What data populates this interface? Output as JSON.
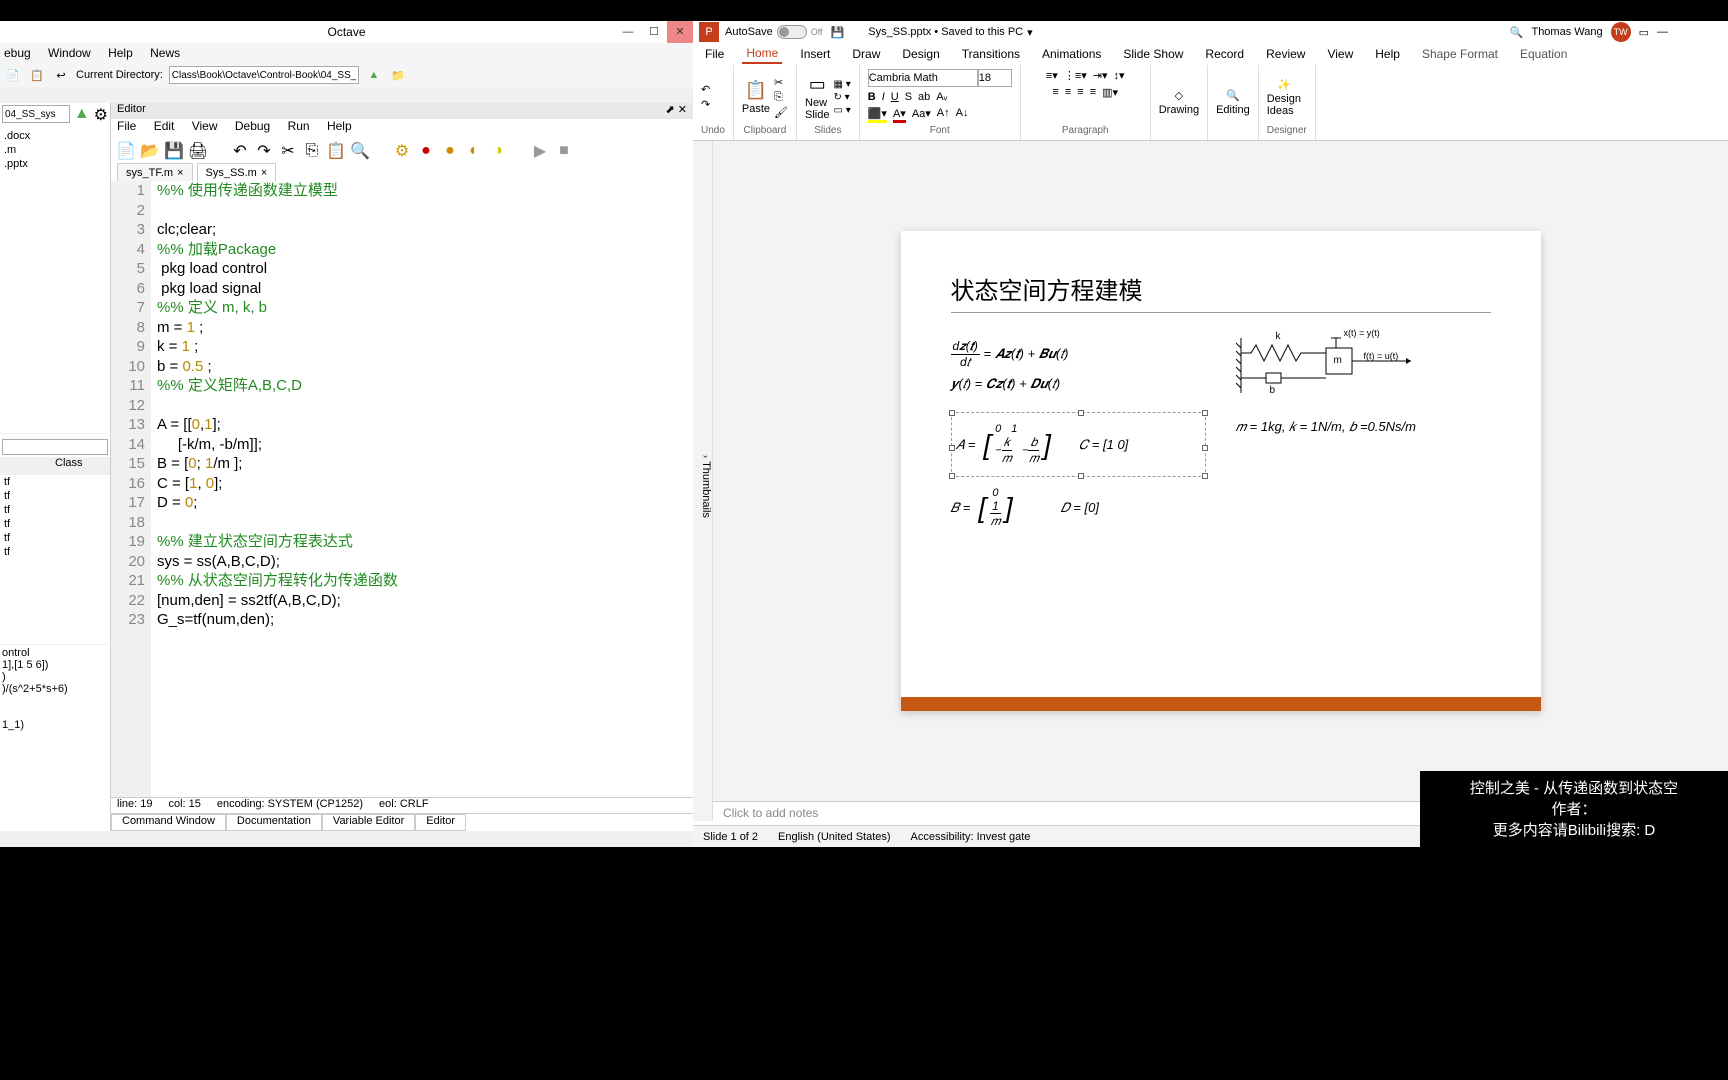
{
  "octave": {
    "title": "Octave",
    "menu": [
      "ebug",
      "Window",
      "Help",
      "News"
    ],
    "current_dir_label": "Current Directory:",
    "current_dir": "Class\\Book\\Octave\\Control-Book\\04_SS_sys",
    "files": {
      "sel": "04_SS_sys",
      "list": [
        ".docx",
        ".m",
        ".pptx"
      ]
    },
    "ws": {
      "headers": [
        "",
        "Class"
      ],
      "rows": [
        "tf",
        "tf",
        "tf",
        "tf",
        "tf",
        "tf"
      ]
    },
    "cmd": "ontrol\n1],[1 5 6])\n)\n)/(s^2+5*s+6)\n\n\n1_1)\n",
    "editor": {
      "pane": "Editor",
      "menu": [
        "File",
        "Edit",
        "View",
        "Debug",
        "Run",
        "Help"
      ],
      "tabs": [
        {
          "name": "sys_TF.m"
        },
        {
          "name": "Sys_SS.m",
          "active": true
        }
      ],
      "code": [
        {
          "n": 1,
          "h": "<span class='c'>%% 使用传递函数建立模型</span>"
        },
        {
          "n": 2,
          "h": ""
        },
        {
          "n": 3,
          "h": "clc;clear;"
        },
        {
          "n": 4,
          "h": "<span class='c'>%% 加载Package</span>"
        },
        {
          "n": 5,
          "h": " pkg load control"
        },
        {
          "n": 6,
          "h": " pkg load signal"
        },
        {
          "n": 7,
          "h": "<span class='c'>%% 定义 m, k, b</span>"
        },
        {
          "n": 8,
          "h": "m = <span class='n'>1</span> ;"
        },
        {
          "n": 9,
          "h": "k = <span class='n'>1</span> ;"
        },
        {
          "n": 10,
          "h": "b = <span class='n'>0.5</span> ;"
        },
        {
          "n": 11,
          "h": "<span class='c'>%% 定义矩阵A,B,C,D</span>"
        },
        {
          "n": 12,
          "h": ""
        },
        {
          "n": 13,
          "h": "A = [[<span class='n'>0</span>,<span class='n'>1</span>];"
        },
        {
          "n": 14,
          "h": "     [-k/m, -b/m]];"
        },
        {
          "n": 15,
          "h": "B = [<span class='n'>0</span>; <span class='n'>1</span>/m ];"
        },
        {
          "n": 16,
          "h": "C = [<span class='n'>1</span>, <span class='n'>0</span>];"
        },
        {
          "n": 17,
          "h": "D = <span class='n'>0</span>;"
        },
        {
          "n": 18,
          "h": ""
        },
        {
          "n": 19,
          "h": "<span class='c'>%% 建立状态空间方程表达式</span>"
        },
        {
          "n": 20,
          "h": "sys = ss(A,B,C,D);"
        },
        {
          "n": 21,
          "h": "<span class='c'>%% 从状态空间方程转化为传递函数</span>"
        },
        {
          "n": 22,
          "h": "[num,den] = ss2tf(A,B,C,D);"
        },
        {
          "n": 23,
          "h": "G_s=tf(num,den);"
        }
      ],
      "status": {
        "line": "line: 19",
        "col": "col: 15",
        "enc": "encoding: SYSTEM (CP1252)",
        "eol": "eol: CRLF"
      },
      "btabs": [
        "Command Window",
        "Documentation",
        "Variable Editor",
        "Editor"
      ]
    }
  },
  "pp": {
    "autosave": "AutoSave",
    "off": "Off",
    "save_icon": "save",
    "docname": "Sys_SS.pptx • Saved to this PC",
    "user": "Thomas Wang",
    "initials": "TW",
    "tabs": [
      "File",
      "Home",
      "Insert",
      "Draw",
      "Design",
      "Transitions",
      "Animations",
      "Slide Show",
      "Record",
      "Review",
      "View",
      "Help"
    ],
    "ctx_tabs": [
      "Shape Format",
      "Equation"
    ],
    "active_tab": "Home",
    "ribbon": {
      "undo": "Undo",
      "clipboard": "Clipboard",
      "paste": "Paste",
      "slides": "Slides",
      "new_slide": "New\nSlide",
      "font": "Font",
      "font_name": "Cambria Math",
      "font_size": "18",
      "paragraph": "Paragraph",
      "drawing": "Drawing",
      "editing": "Editing",
      "designideas": "Design\nIdeas",
      "designer": "Designer"
    },
    "thumbnails": "Thumbnails",
    "slide": {
      "title": "状态空间方程建模",
      "eq1": "= 𝑨𝒛(𝒕) + 𝑩𝒖(𝑡)",
      "eq1_num": "d𝒛(𝒕)",
      "eq1_den": "d𝑡",
      "eq2": "𝒚(𝑡) = 𝑪𝒛(𝒕) + 𝑫𝒖(𝑡)",
      "A": "𝐴 =",
      "C": "𝐶 = [1   0]",
      "B": "𝐵 =",
      "D": "𝐷 = [0]",
      "diag_x": "x(t) = y(t)",
      "diag_f": "f(t) = u(t)",
      "diag_k": "k",
      "diag_m": "m",
      "diag_b": "b",
      "params": "𝑚 = 1kg, 𝑘 = 1N/m, 𝑏 =0.5Ns/m"
    },
    "notes": "Click to add notes",
    "status": {
      "slide": "Slide 1 of 2",
      "lang": "English (United States)",
      "acc": "Accessibility: Invest gate"
    }
  },
  "overlay": {
    "l1": "控制之美 - 从传递函数到状态空",
    "l2": "作者：",
    "l3": "更多内容请Bilibili搜索: D"
  }
}
